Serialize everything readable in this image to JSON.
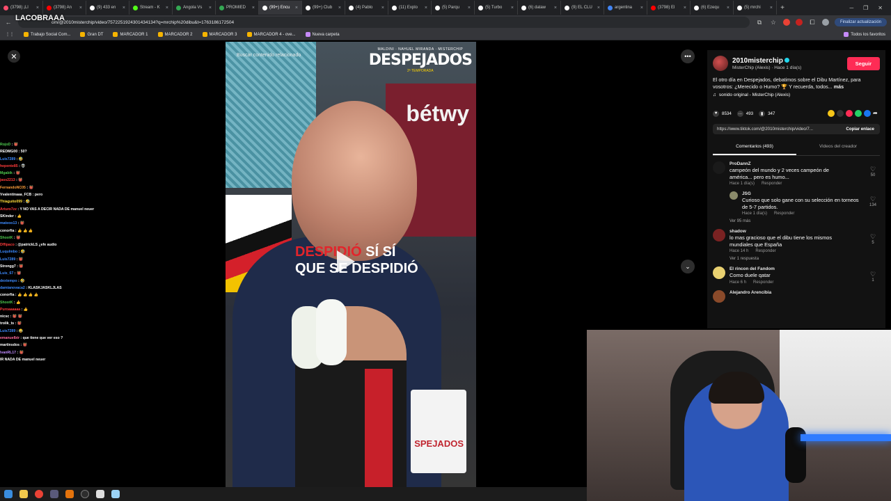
{
  "browser": {
    "tabs": [
      {
        "label": "(3798) ¡Ll",
        "color": "#ff4d6d"
      },
      {
        "label": "(3798) An",
        "color": "#ff0000"
      },
      {
        "label": "(9) 433 en",
        "color": "#ffffff"
      },
      {
        "label": "Stream - K",
        "color": "#53fc18"
      },
      {
        "label": "Angola Vs",
        "color": "#34a853"
      },
      {
        "label": "PROMIED",
        "color": "#34a853"
      },
      {
        "label": "(99+) Encu",
        "color": "#ffffff",
        "active": true
      },
      {
        "label": "(99+) Club",
        "color": "#ffffff"
      },
      {
        "label": "(4) Pablo",
        "color": "#ffffff"
      },
      {
        "label": "(11) Explo",
        "color": "#ffffff"
      },
      {
        "label": "(5) Parqu",
        "color": "#ffffff"
      },
      {
        "label": "(5) Turbo",
        "color": "#ffffff"
      },
      {
        "label": "(6) dataw",
        "color": "#ffffff"
      },
      {
        "label": "(9) EL CLU",
        "color": "#ffffff"
      },
      {
        "label": "argentina",
        "color": "#4285f4"
      },
      {
        "label": "(3798) El",
        "color": "#ff0000"
      },
      {
        "label": "(6) Ezequ",
        "color": "#ffffff"
      },
      {
        "label": "(5) mrchi",
        "color": "#ffffff"
      }
    ],
    "new_tab": "+",
    "url": "om/@2010misterchip/video/7572251924301434134?q=mrchip%20dibu&t=1763186172504",
    "update_button": "Finalizar actualización",
    "bookmarks": [
      "Trabajo Social Com...",
      "Gran DT",
      "MARCADOR 1",
      "MARCADOR 2",
      "MARCADOR 3",
      "MARCADOR 4 - ove...",
      "Nueva carpeta"
    ],
    "all_bookmarks": "Todos los favoritos"
  },
  "stream_logo": "LACOBRAAA",
  "chat": [
    {
      "user": "RojoD",
      "color": "#4ec94e",
      "msg": "👹"
    },
    {
      "user": "REDMG00",
      "color": "#ffffff",
      "msg": "50?"
    },
    {
      "user": "Luis7289",
      "color": "#3d8bff",
      "msg": "🤣"
    },
    {
      "user": "hepente85",
      "color": "#ff3b3b",
      "msg": "👽"
    },
    {
      "user": "Mgabik",
      "color": "#4ec94e",
      "msg": "👹"
    },
    {
      "user": "jass2213",
      "color": "#ff3b3b",
      "msg": "👹"
    },
    {
      "user": "FernandoNC05",
      "color": "#ff9f3b",
      "msg": "👹"
    },
    {
      "user": "Vvalentinaaa_FCB",
      "color": "#ffffff",
      "msg": "pero"
    },
    {
      "user": "Thiaguito099",
      "color": "#ffde3b",
      "msg": "🤣"
    },
    {
      "user": "Arturo7zz",
      "color": "#ff3b3b",
      "msg": "Y NO VAS A DECIR NADA DE manuel neuer"
    },
    {
      "user": "SKinder",
      "color": "#ffffff",
      "msg": "👍"
    },
    {
      "user": "mateoo13",
      "color": "#3d8bff",
      "msg": "👹"
    },
    {
      "user": "conorfia",
      "color": "#ffffff",
      "msg": "👍 👍 👍"
    },
    {
      "user": "ShootK",
      "color": "#4ec94e",
      "msg": "👹"
    },
    {
      "user": "Dffipaco",
      "color": "#ff3b3b",
      "msg": "@patrickLS ¿efe audio"
    },
    {
      "user": "Luqulmbo",
      "color": "#3d8bff",
      "msg": "🤣"
    },
    {
      "user": "Luis7289",
      "color": "#3d8bff",
      "msg": "👹"
    },
    {
      "user": "Strongg7",
      "color": "#ffffff",
      "msg": "👹"
    },
    {
      "user": "Luis_67",
      "color": "#3d8bff",
      "msg": "👹"
    },
    {
      "user": "dextempo",
      "color": "#3d8bff",
      "msg": "🤣"
    },
    {
      "user": "damianovaca2",
      "color": "#3d8bff",
      "msg": "KLASKJASKLJLAS"
    },
    {
      "user": "conorfia",
      "color": "#ffffff",
      "msg": "👍 👍 👍 👍"
    },
    {
      "user": "ShootK",
      "color": "#4ec94e",
      "msg": "👍"
    },
    {
      "user": "Puroaaaaaa",
      "color": "#ff3b3b",
      "msg": "👍"
    },
    {
      "user": "nicsc",
      "color": "#ffffff",
      "msg": "👹 👹"
    },
    {
      "user": "trolik_ts",
      "color": "#ffffff",
      "msg": "👹"
    },
    {
      "user": "Luis7289",
      "color": "#3d8bff",
      "msg": "😂"
    },
    {
      "user": "emanuelbtr",
      "color": "#ff6b9d",
      "msg": "que tiene que ver eso ?"
    },
    {
      "user": "martinsdos",
      "color": "#ffffff",
      "msg": "👹"
    },
    {
      "user": "IvanRL17",
      "color": "#c08bff",
      "msg": "👹"
    },
    {
      "user": "",
      "color": "#ffffff",
      "msg": "IR NADA DE manuel neuer"
    }
  ],
  "video": {
    "search_placeholder": "Buscar contenido relacionado",
    "brand_small": "MALDINI · NAHUEL MIRANDA · MISTERCHIP",
    "brand_big": "DESPEJADOS",
    "brand_season": "2ª TEMPORADA",
    "caption_line1_red": "DESPIDIÓ",
    "caption_line1_white": " SÍ SÍ",
    "caption_line2": "QUE SE DESPIDIÓ",
    "sponsor": "bétwy",
    "mug_text": "SPEJADOS"
  },
  "panel": {
    "author": "2010misterchip",
    "author_sub": "MisterChip (Alexis) · Hace 1 día(s)",
    "follow": "Seguir",
    "description": "El otro día en Despejados, debatimos sobre el Dibu Martínez, para vosotros: ¿Merecido o Humo? 🏆 Y recuerda, todos...",
    "more": "más",
    "sound": "sonido original - MisterChip (Alexis)",
    "likes": "8534",
    "comments": "493",
    "saves": "347",
    "link": "https://www.tiktok.com/@2010misterchip/video/7...",
    "copy_link": "Copiar enlace",
    "tab_comments": "Comentarios (493)",
    "tab_creator": "Videos del creador",
    "comment_list": [
      {
        "user": "ProDannZ",
        "text": "campeón del mundo y 2 veces campeón de américa... pero es humo...",
        "time": "Hace 1 día(s)",
        "reply": "Responder",
        "likes": "50",
        "avatar": "#1a1a1a"
      },
      {
        "user": "JSG",
        "text": "Curioso que solo gane con su selección en torneos de 5-7 partidos.",
        "time": "Hace 1 día(s)",
        "reply": "Responder",
        "likes": "134",
        "avatar": "#8a8a6a",
        "is_reply": true
      },
      {
        "user": "shadow",
        "text": "lo mas gracioso que el dibu tiene los mismos mundiales que España",
        "time": "Hace 14 h",
        "reply": "Responder",
        "likes": "5",
        "avatar": "#7a2222"
      },
      {
        "user": "El rincon del Fandom",
        "text": "Como duele qatar",
        "time": "Hace 6 h",
        "reply": "Responder",
        "likes": "1",
        "avatar": "#e8d070"
      },
      {
        "user": "Alejandro Arencibia",
        "text": "",
        "time": "",
        "reply": "",
        "likes": "",
        "avatar": "#8a4a2a"
      }
    ],
    "view_more_1": "Ver 95 más",
    "view_more_2": "Ver 1 respuesta"
  }
}
